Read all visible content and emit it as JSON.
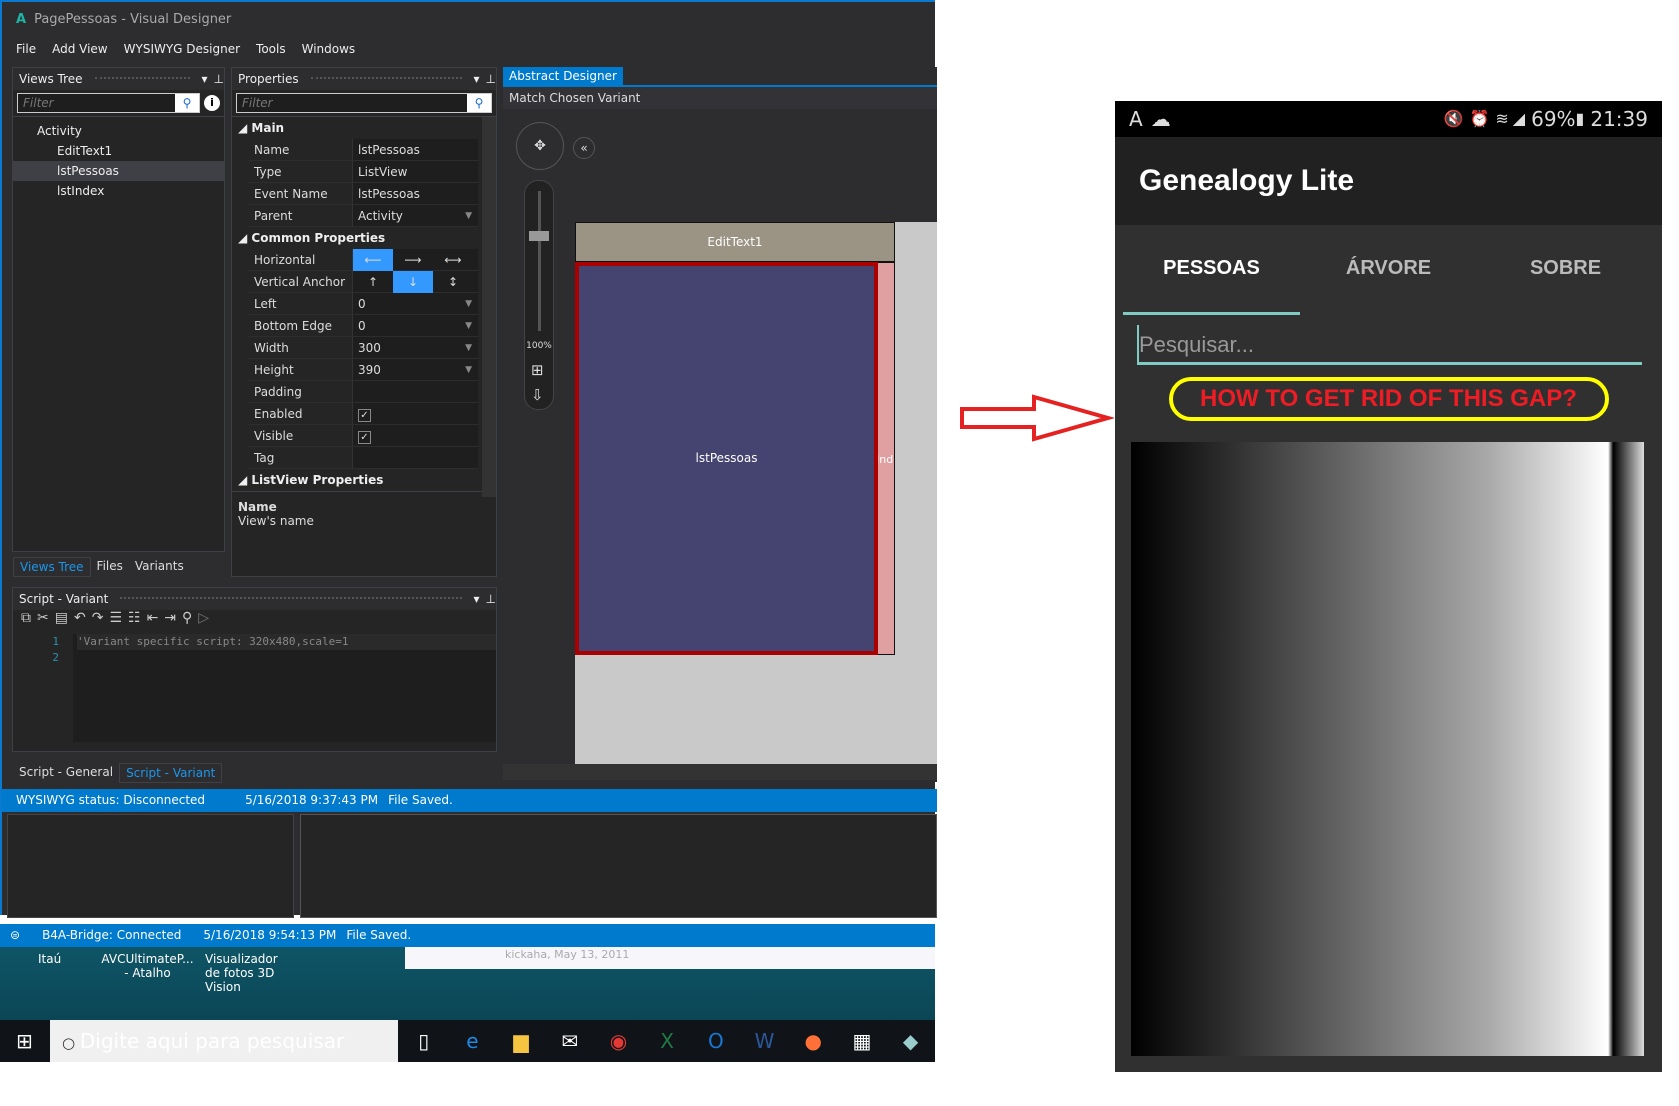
{
  "app": {
    "logo": "A",
    "title": "PagePessoas - Visual Designer",
    "menu": [
      "File",
      "Add View",
      "WYSIWYG Designer",
      "Tools",
      "Windows"
    ]
  },
  "views_tree": {
    "title": "Views Tree",
    "filter_placeholder": "Filter",
    "items": [
      "Activity",
      "EditText1",
      "lstPessoas",
      "lstIndex"
    ],
    "tabs": [
      "Views Tree",
      "Files",
      "Variants"
    ]
  },
  "properties": {
    "title": "Properties",
    "filter_placeholder": "Filter",
    "main": {
      "label": "Main",
      "rows": [
        [
          "Name",
          "lstPessoas"
        ],
        [
          "Type",
          "ListView"
        ],
        [
          "Event Name",
          "lstPessoas"
        ],
        [
          "Parent",
          "Activity"
        ]
      ]
    },
    "common": {
      "label": "Common Properties",
      "horizontal_anchor": "Horizontal Anchor",
      "vertical_anchor": "Vertical Anchor",
      "rows": [
        [
          "Left",
          "0"
        ],
        [
          "Bottom Edge Dis...",
          "0"
        ],
        [
          "Width",
          "300"
        ],
        [
          "Height",
          "390"
        ],
        [
          "Padding",
          ""
        ]
      ],
      "enabled": "Enabled",
      "visible": "Visible",
      "tag": "Tag"
    },
    "listview": {
      "label": "ListView Properties"
    },
    "help_title": "Name",
    "help_text": "View's name"
  },
  "script": {
    "title": "Script - Variant",
    "lines": [
      "1",
      "2"
    ],
    "code": "'Variant specific script: 320x480,scale=1",
    "tabs": [
      "Script - General",
      "Script - Variant"
    ]
  },
  "designer": {
    "tab": "Abstract Designer",
    "variant": "Match Chosen Variant",
    "zoom": "100%",
    "edittext_label": "EditText1",
    "listview_label": "lstPessoas",
    "index_label": "Ind"
  },
  "status1": {
    "wysiwyg": "WYSIWYG status: Disconnected",
    "time": "5/16/2018 9:37:43 PM",
    "msg": "File Saved."
  },
  "status2": {
    "bridge": "B4A-Bridge: Connected",
    "time": "5/16/2018 9:54:13 PM",
    "msg": "File Saved."
  },
  "desktop": {
    "icons": [
      "Itaú",
      "AVCUltimateP... - Atalho",
      "Visualizador de fotos 3D Vision"
    ],
    "note": "kickaha, May 13, 2011"
  },
  "taskbar": {
    "search_placeholder": "Digite aqui para pesquisar"
  },
  "phone": {
    "battery": "69%",
    "time": "21:39",
    "app_title": "Genealogy Lite",
    "tabs": [
      "PESSOAS",
      "ÁRVORE",
      "SOBRE"
    ],
    "search_placeholder": "Pesquisar...",
    "accent": "#80cbc4"
  },
  "annotation": {
    "text": "HOW TO GET RID OF THIS GAP?",
    "color": "#ee1c24",
    "outline": "#ffff00"
  }
}
